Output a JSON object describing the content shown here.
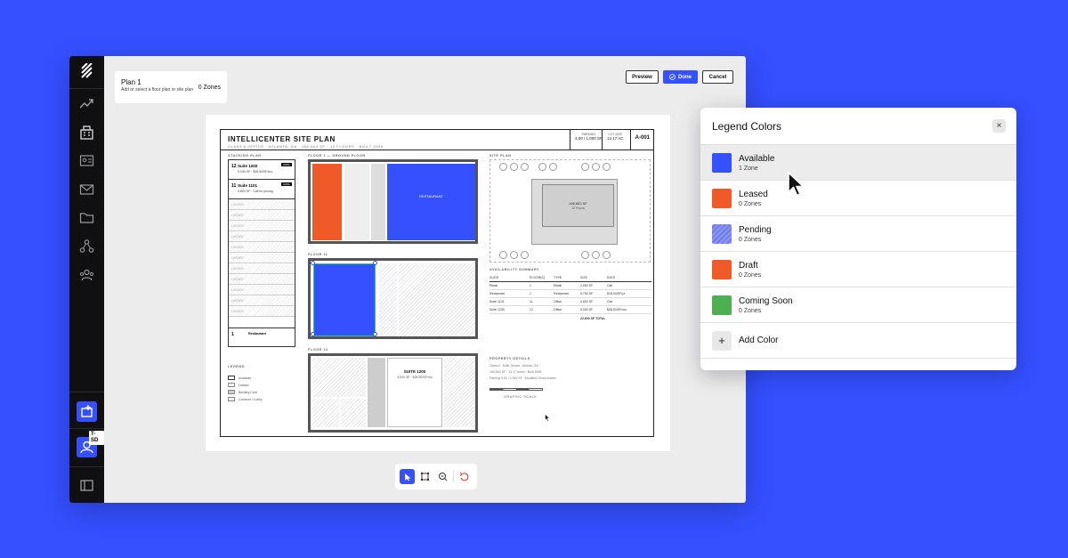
{
  "app": {
    "plan_title": "Plan 1",
    "plan_subtitle": "Add or select a floor plan or site plan",
    "zone_count": "0 Zones",
    "preview_label": "Preview",
    "done_label": "Done",
    "cancel_label": "Cancel",
    "user_tag": "T-SD"
  },
  "sidebar": {
    "icons": [
      "logo-icon",
      "analytics-icon",
      "building-icon",
      "card-icon",
      "mail-icon",
      "folder-icon",
      "network-icon",
      "team-icon",
      "add-content-icon",
      "user-icon",
      "sidebar-toggle-icon"
    ]
  },
  "drawing": {
    "title": "INTELLICENTER SITE PLAN",
    "subtitle": "CLASS A OFFICE · ATLANTA, GA · 166,863 SF · 12 FLOORS · BUILT 2008",
    "parking_label": "PARKING",
    "parking_value": "3.00 / 1,000 SF",
    "lot_label": "LOT SIZE",
    "lot_value": "13.17 AC",
    "sheet": "A-001",
    "stacking_plan_label": "STACKING PLAN",
    "floor1_label": "FLOOR 1 — GROUND FLOOR",
    "floor11_label": "FLOOR 11",
    "floor12_label": "FLOOR 12",
    "site_plan_label": "SITE PLAN",
    "availability_label": "AVAILABILITY SUMMARY",
    "property_label": "PROPERTY DETAILS",
    "legend_label": "LEGEND",
    "stack_12": "12",
    "stack_12_name": "Suite 1200",
    "stack_12_detail": "9,000 SF · $28.50/SF/mo",
    "stack_11": "11",
    "stack_11_name": "Suite 1101",
    "stack_11_detail": "4,800 SF · Call for pricing",
    "stack_badge": "AVAIL",
    "stack_1": "1",
    "stack_1_name": "Restaurant",
    "stack_leased": "LEASED",
    "legend_items": [
      "Available",
      "Leased",
      "Building Core",
      "Common / Lobby"
    ],
    "restaurant_label": "RESTAURANT",
    "suite1200_label": "SUITE 1200",
    "suite1200_detail": "9,000 SF · $28.50/SF/mo",
    "site_building": "166,863 SF",
    "site_floors": "12 Floors",
    "table_headers": [
      "SUITE",
      "FLOOR(S)",
      "TYPE",
      "SIZE",
      "RATE"
    ],
    "table_rows": [
      [
        "Retail",
        "1",
        "Retail",
        "2,050 SF",
        "Call"
      ],
      [
        "Restaurant",
        "1",
        "Restaurant",
        "6,750 SF",
        "$18.00/SF/yr"
      ],
      [
        "Suite 1101",
        "11",
        "Office",
        "4,800 SF",
        "Call"
      ],
      [
        "Suite 1200",
        "12",
        "Office",
        "9,000 SF",
        "$28.50/SF/mo"
      ]
    ],
    "table_total": "22,600 SF TOTAL",
    "property_lines": [
      "Class A · Multi-Tenant · Atlanta, GA",
      "166,863 SF · 13.17 Acres · Built 2008",
      "Parking 3.00 / 1,000 SF · Modified Gross leases"
    ],
    "scale_label": "GRAPHIC SCALE"
  },
  "legend_panel": {
    "title": "Legend Colors",
    "close": "×",
    "items": [
      {
        "name": "Available",
        "count": "1 Zone",
        "color": "#3450ff"
      },
      {
        "name": "Leased",
        "count": "0 Zones",
        "color": "#f05a28"
      },
      {
        "name": "Pending",
        "count": "0 Zones",
        "color": "#7f8cf0"
      },
      {
        "name": "Draft",
        "count": "0 Zones",
        "color": "#f05a28"
      },
      {
        "name": "Coming Soon",
        "count": "0 Zones",
        "color": "#4caf50"
      }
    ],
    "add_label": "Add Color",
    "add_symbol": "+"
  },
  "toolbar": {
    "tools": [
      "select-arrow-icon",
      "polygon-icon",
      "zone-search-icon",
      "undo-icon"
    ]
  }
}
